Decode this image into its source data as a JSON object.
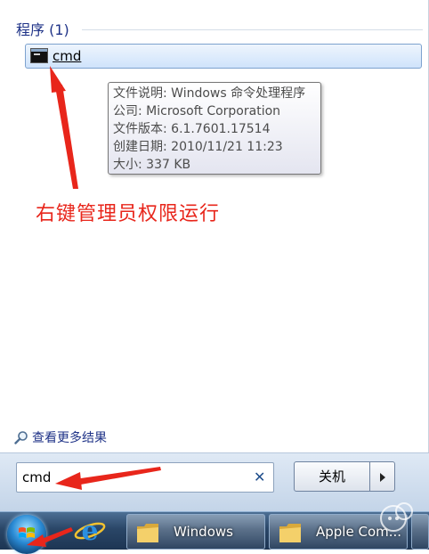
{
  "start_menu": {
    "section_title": "程序 (1)",
    "result": {
      "label": "cmd"
    },
    "tooltip": {
      "lines": [
        "文件说明: Windows 命令处理程序",
        "公司: Microsoft Corporation",
        "文件版本: 6.1.7601.17514",
        "创建日期: 2010/11/21 11:23",
        "大小: 337 KB"
      ]
    },
    "annotation": "右键管理员权限运行",
    "more_results": "查看更多结果",
    "search": {
      "value": "cmd"
    },
    "shutdown_label": "关机"
  },
  "taskbar": {
    "buttons": [
      {
        "label": "Windows"
      },
      {
        "label": "Apple Com..."
      }
    ]
  },
  "colors": {
    "accent_blue": "#1e3287",
    "annotation_red": "#e8261b",
    "taskbar_dark": "#1d3553"
  },
  "icons": [
    "cmd-icon",
    "magnifier-icon",
    "clear-icon",
    "chevron-right-icon",
    "windows-start-icon",
    "internet-explorer-icon",
    "folder-icon",
    "watermark-icon"
  ]
}
